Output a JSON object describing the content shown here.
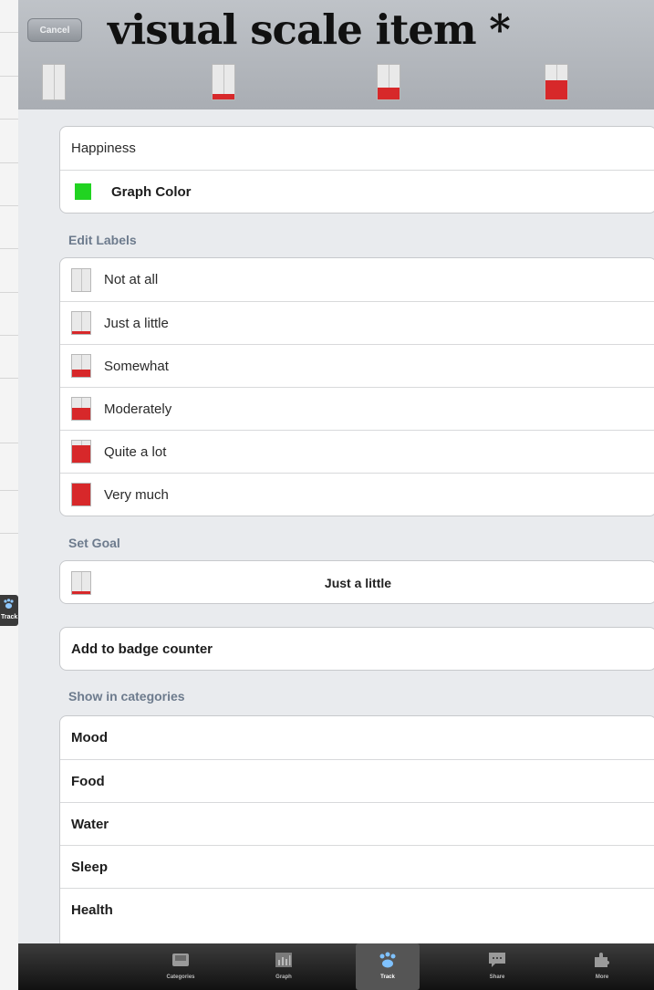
{
  "header": {
    "cancel_label": "Cancel",
    "title": "visual scale item *",
    "scale_tabs": [
      {
        "level": 0
      },
      {
        "level": 0.15
      },
      {
        "level": 0.35
      },
      {
        "level": 0.55
      }
    ]
  },
  "item": {
    "name": "Happiness",
    "graph_color_label": "Graph Color",
    "graph_color": "#21d321"
  },
  "labels_section": {
    "heading": "Edit Labels",
    "items": [
      {
        "label": "Not at all",
        "level": 0
      },
      {
        "label": "Just a little",
        "level": 0.12
      },
      {
        "label": "Somewhat",
        "level": 0.35
      },
      {
        "label": "Moderately",
        "level": 0.55
      },
      {
        "label": "Quite a lot",
        "level": 0.8
      },
      {
        "label": "Very much",
        "level": 1.0
      }
    ]
  },
  "goal_section": {
    "heading": "Set Goal",
    "value": "Just a little",
    "level": 0.12
  },
  "badge": {
    "label": "Add to badge counter"
  },
  "categories_section": {
    "heading": "Show in categories",
    "items": [
      "Mood",
      "Food",
      "Water",
      "Sleep",
      "Health"
    ]
  },
  "tabbar": {
    "tabs": [
      {
        "label": "Categories",
        "icon": "inbox-icon"
      },
      {
        "label": "Graph",
        "icon": "chart-icon"
      },
      {
        "label": "Track",
        "icon": "paw-icon",
        "active": true
      },
      {
        "label": "Share",
        "icon": "chat-icon"
      },
      {
        "label": "More",
        "icon": "puzzle-icon"
      }
    ]
  },
  "background": {
    "track_label": "Track"
  },
  "colors": {
    "scale_fill": "#d7282a",
    "section_label": "#6d7b8d"
  }
}
